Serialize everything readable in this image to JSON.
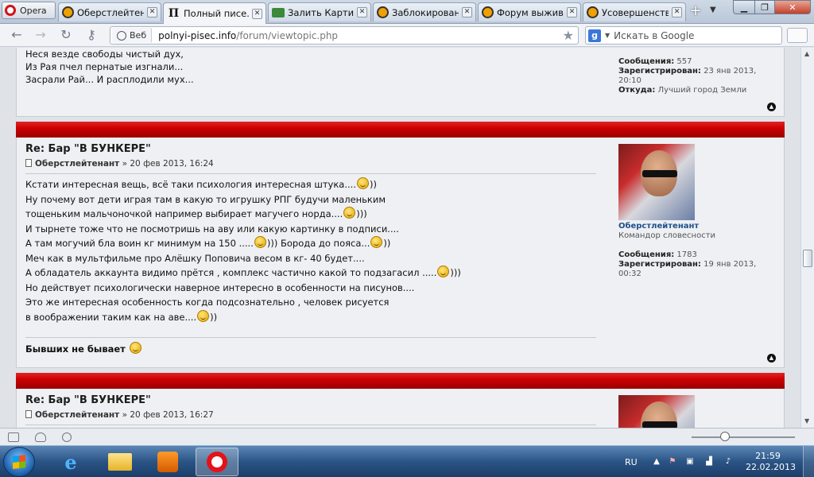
{
  "browser": {
    "menu_label": "Opera",
    "tabs": [
      {
        "title": "Оберстлейтен…"
      },
      {
        "title": "Полный писе…"
      },
      {
        "title": "Залить Картин…"
      },
      {
        "title": "Заблокирован…"
      },
      {
        "title": "Форум выжив…"
      },
      {
        "title": "Усовершенств…"
      }
    ],
    "address_badge": "Веб",
    "url_host": "polnyi-pisec.info",
    "url_path": "/forum/viewtopic.php",
    "search_placeholder": "Искать в Google"
  },
  "posts": [
    {
      "lines": [
        "Неся везде свободы чистый дух,",
        "Из Рая пчел пернатые изгнали...",
        "Засрали Рай... И расплодили мух..."
      ],
      "profile": {
        "messages_label": "Сообщения:",
        "messages_value": "557",
        "registered_label": "Зарегистрирован:",
        "registered_value": "23 янв 2013, 20:10",
        "from_label": "Откуда:",
        "from_value": "Лучший город Земли"
      }
    },
    {
      "title": "Re: Бар \"В БУНКЕРЕ\"",
      "author": "Оберстлейтенант",
      "date": " » 20 фев 2013, 16:24",
      "lines": [
        "Кстати интересная вещь, всё таки психология интересная штука....",
        "Ну почему вот дети играя там в какую то игрушку РПГ будучи маленьким",
        "тощеньким мальчоночкой например выбирает магучего норда....",
        "И тырнете тоже что не посмотришь на аву или какую картинку в подписи....",
        "А там могучий бла воин кг минимум на 150 .....",
        "Меч как в мультфильме про Алёшку Поповича весом в кг- 40 будет....",
        "А обладатель аккаунта видимо прётся , комплекс частично какой то подзагасил .....",
        "Но действует психологически наверное интересно в особенности на писунов....",
        "Это же интересная особенность когда подсознательно , человек рисуется",
        "в воображении таким как на аве...."
      ],
      "tails": [
        "))",
        "",
        ")))",
        "",
        ")))",
        "",
        ")))",
        "",
        "",
        "))"
      ],
      "mid_text": " Борода до пояса...",
      "mid_tail": "))",
      "signature": "Бывших не бывает",
      "profile": {
        "username": "Оберстлейтенант",
        "rank": "Командор словесности",
        "messages_label": "Сообщения:",
        "messages_value": "1783",
        "registered_label": "Зарегистрирован:",
        "registered_value": "19 янв 2013, 00:32"
      }
    },
    {
      "title": "Re: Бар \"В БУНКЕРЕ\"",
      "author": "Оберстлейтенант",
      "date": " » 20 фев 2013, 16:27"
    }
  ],
  "taskbar": {
    "lang": "RU",
    "time": "21:59",
    "date": "22.02.2013"
  }
}
